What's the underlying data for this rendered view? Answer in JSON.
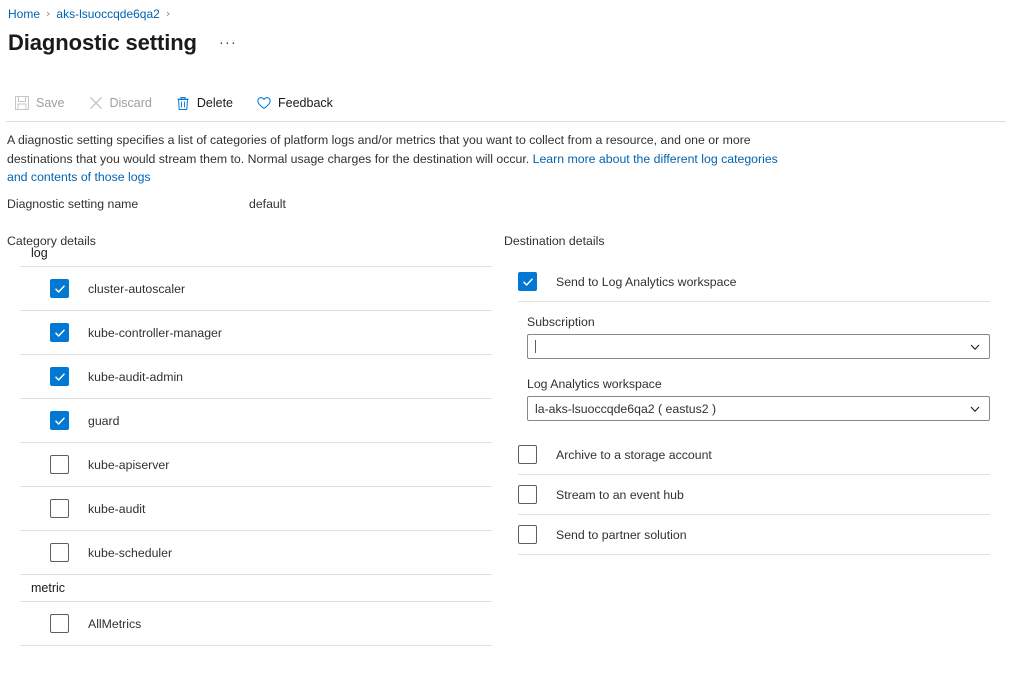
{
  "breadcrumb": {
    "items": [
      {
        "label": "Home"
      },
      {
        "label": "aks-lsuoccqde6qa2"
      }
    ],
    "separator": "›"
  },
  "header": {
    "title": "Diagnostic setting",
    "more_menu": "···"
  },
  "toolbar": {
    "save_label": "Save",
    "discard_label": "Discard",
    "delete_label": "Delete",
    "feedback_label": "Feedback"
  },
  "description": {
    "text_before_link": "A diagnostic setting specifies a list of categories of platform logs and/or metrics that you want to collect from a resource, and one or more destinations that you would stream them to. Normal usage charges for the destination will occur. ",
    "link_text": "Learn more about the different log categories and contents of those logs"
  },
  "setting_name": {
    "label": "Diagnostic setting name",
    "value": "default"
  },
  "category_details": {
    "heading": "Category details",
    "groups": [
      {
        "name": "log",
        "items": [
          {
            "label": "cluster-autoscaler",
            "checked": true
          },
          {
            "label": "kube-controller-manager",
            "checked": true
          },
          {
            "label": "kube-audit-admin",
            "checked": true
          },
          {
            "label": "guard",
            "checked": true
          },
          {
            "label": "kube-apiserver",
            "checked": false
          },
          {
            "label": "kube-audit",
            "checked": false
          },
          {
            "label": "kube-scheduler",
            "checked": false
          }
        ]
      },
      {
        "name": "metric",
        "items": [
          {
            "label": "AllMetrics",
            "checked": false
          }
        ]
      }
    ]
  },
  "destination_details": {
    "heading": "Destination details",
    "log_analytics": {
      "label": "Send to Log Analytics workspace",
      "checked": true,
      "subscription": {
        "label": "Subscription",
        "value": ""
      },
      "workspace": {
        "label": "Log Analytics workspace",
        "value": "la-aks-lsuoccqde6qa2 ( eastus2 )"
      }
    },
    "options": [
      {
        "label": "Archive to a storage account",
        "checked": false
      },
      {
        "label": "Stream to an event hub",
        "checked": false
      },
      {
        "label": "Send to partner solution",
        "checked": false
      }
    ]
  },
  "colors": {
    "accent": "#0078d4",
    "link": "#0063b1",
    "divider": "#e1dfdd",
    "text": "#323130",
    "disabled": "#a19f9d"
  }
}
